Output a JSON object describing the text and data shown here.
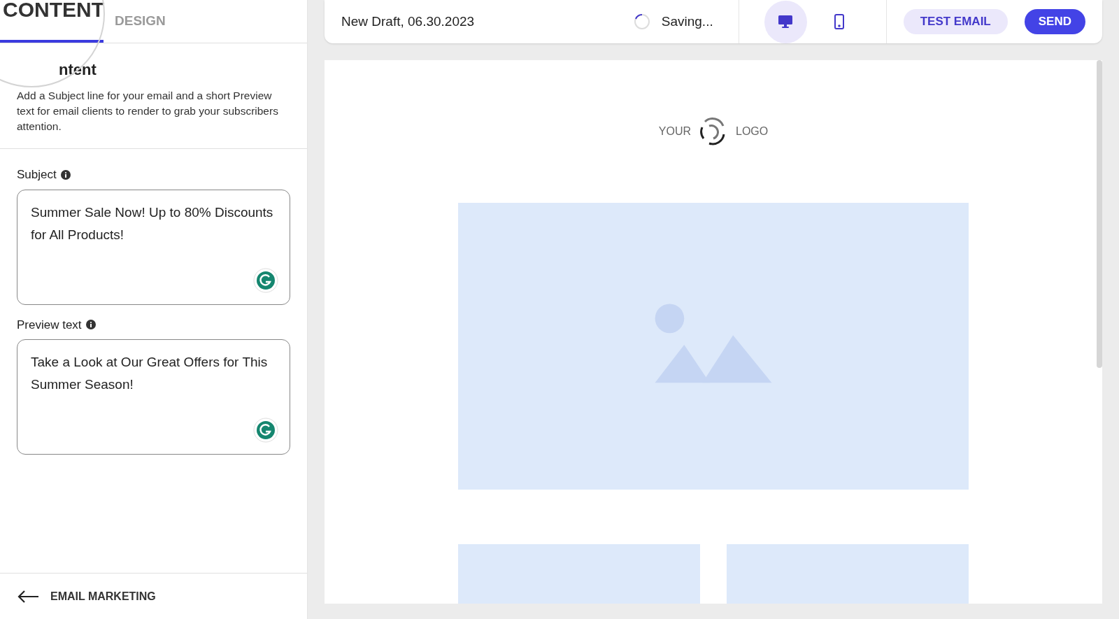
{
  "tabs": [
    {
      "label": "CONTENT",
      "selected": true
    },
    {
      "label": "DESIGN",
      "selected": false
    }
  ],
  "section": {
    "heading": "ntent",
    "description": "Add a Subject line for your email and a short Preview text for email clients to render to grab your subscribers attention."
  },
  "fields": [
    {
      "label": "Subject",
      "value": "Summer Sale Now! Up to 80% Discounts for All Products!"
    },
    {
      "label": "Preview text",
      "value": "Take a Look at Our Great Offers for This Summer Season!"
    }
  ],
  "back_link": "EMAIL MARKETING",
  "toolbar": {
    "title": "New Draft, 06.30.2023",
    "status": "Saving...",
    "devices": [
      {
        "kind": "desktop",
        "selected": true
      },
      {
        "kind": "mobile",
        "selected": false
      }
    ],
    "test_button": "TEST EMAIL",
    "send_button": "SEND"
  },
  "email": {
    "logo_left": "YOUR",
    "logo_right": "LOGO"
  }
}
